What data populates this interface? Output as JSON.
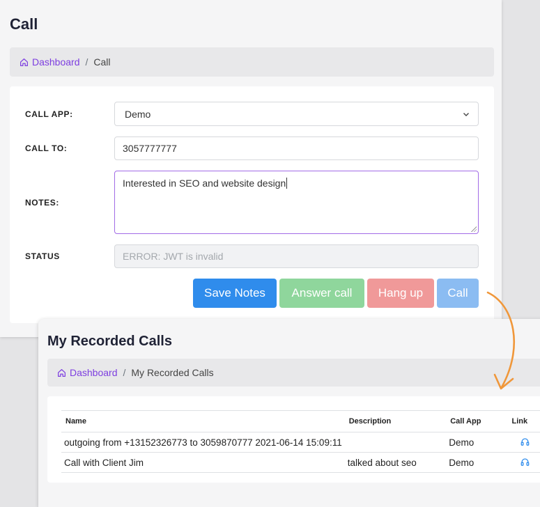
{
  "call_page": {
    "title": "Call",
    "breadcrumb": {
      "home": "Dashboard",
      "separator": "/",
      "current": "Call"
    },
    "form": {
      "call_app": {
        "label": "CALL APP:",
        "value": "Demo"
      },
      "call_to": {
        "label": "CALL TO:",
        "value": "3057777777"
      },
      "notes": {
        "label": "NOTES:",
        "value": "Interested in SEO and website design"
      },
      "status": {
        "label": "STATUS",
        "placeholder": "ERROR: JWT is invalid"
      }
    },
    "buttons": {
      "save_notes": "Save Notes",
      "answer_call": "Answer call",
      "hang_up": "Hang up",
      "call": "Call"
    }
  },
  "recorded_calls": {
    "title": "My Recorded Calls",
    "breadcrumb": {
      "home": "Dashboard",
      "separator": "/",
      "current": "My Recorded Calls"
    },
    "table": {
      "headers": {
        "name": "Name",
        "description": "Description",
        "call_app": "Call App",
        "link": "Link"
      },
      "rows": [
        {
          "name": "outgoing from +13152326773 to 3059870777 2021-06-14 15:09:11",
          "description": "",
          "call_app": "Demo",
          "link_icon": "headphones-icon"
        },
        {
          "name": "Call with Client Jim",
          "description": "talked about seo",
          "call_app": "Demo",
          "link_icon": "headphones-icon"
        }
      ]
    }
  },
  "colors": {
    "accent_purple": "#7d3ee0",
    "primary_blue": "#2f8cec",
    "success_green": "#8fd69c",
    "danger_red": "#f09999",
    "info_blue": "#8bbcf2",
    "arrow_orange": "#f0973a"
  }
}
